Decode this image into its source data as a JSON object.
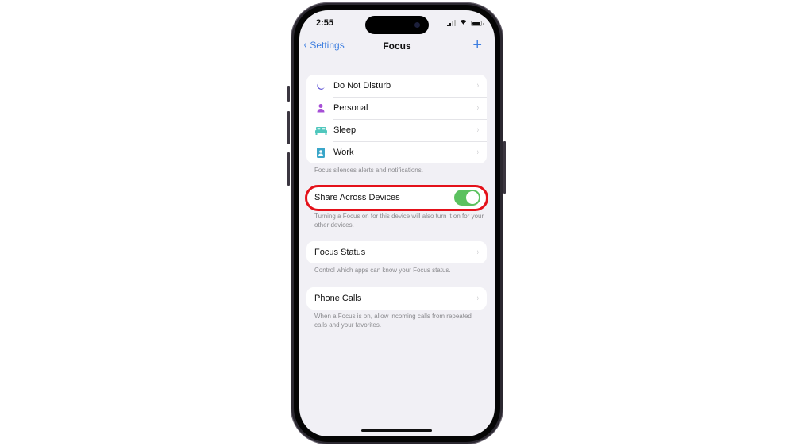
{
  "status_bar": {
    "time": "2:55",
    "signal_icon": "cellular-signal-icon",
    "wifi_icon": "wifi-icon",
    "battery_icon": "battery-icon"
  },
  "nav": {
    "back_label": "Settings",
    "title": "Focus",
    "add_icon": "+"
  },
  "focus_modes": [
    {
      "label": "Do Not Disturb",
      "icon": "moon-icon",
      "color": "#5b4fd4"
    },
    {
      "label": "Personal",
      "icon": "person-icon",
      "color": "#a64fd6"
    },
    {
      "label": "Sleep",
      "icon": "bed-icon",
      "color": "#4fc7bd"
    },
    {
      "label": "Work",
      "icon": "id-badge-icon",
      "color": "#3aa6c9"
    }
  ],
  "focus_modes_footer": "Focus silences alerts and notifications.",
  "share_across_devices": {
    "label": "Share Across Devices",
    "enabled": true,
    "footer": "Turning a Focus on for this device will also turn it on for your other devices."
  },
  "focus_status": {
    "label": "Focus Status",
    "footer": "Control which apps can know your Focus status."
  },
  "phone_calls": {
    "label": "Phone Calls",
    "footer": "When a Focus is on, allow incoming calls from repeated calls and your favorites."
  },
  "chevron": "›",
  "colors": {
    "accent": "#3d7ee0",
    "toggle_on": "#5bc15f",
    "highlight": "#e4111a"
  }
}
